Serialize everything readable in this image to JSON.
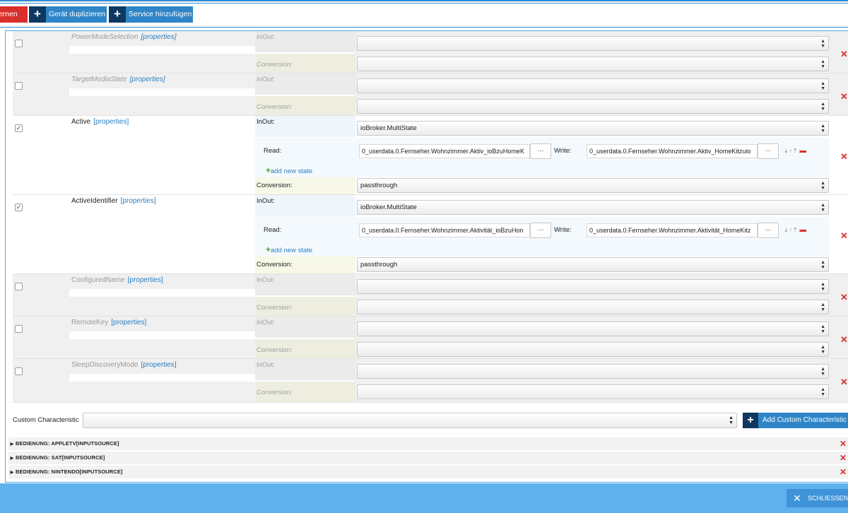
{
  "toolbar": {
    "remove_label": "tfernen",
    "duplicate_label": "Gerät duplizieren",
    "add_service_label": "Service hinzufügen"
  },
  "characteristics": [
    {
      "name": "PowerModeSelection",
      "props": "[properties]",
      "inout_label": "InOut:",
      "inout_value": "",
      "conversion_label": "Conversion:",
      "conversion_value": "",
      "checked": false
    },
    {
      "name": "TargetMediaState",
      "props": "[properties]",
      "inout_label": "InOut:",
      "inout_value": "",
      "conversion_label": "Conversion:",
      "conversion_value": "",
      "checked": false
    },
    {
      "name": "Active",
      "props": "[properties]",
      "inout_label": "InOut:",
      "inout_value": "ioBroker.MultiState",
      "read_label": "Read:",
      "read_value": "0_userdata.0.Fernseher.Wohnzimmer.Aktiv_ioBzuHomeK",
      "write_label": "Write:",
      "write_value": "0_userdata.0.Fernseher.Wohnzimmer.Aktiv_HomeKitzuio",
      "dots": "···",
      "add_state": "add new state",
      "conversion_label": "Conversion:",
      "conversion_value": "passthrough",
      "checked": true
    },
    {
      "name": "ActiveIdentifier",
      "props": "[properties]",
      "inout_label": "InOut:",
      "inout_value": "ioBroker.MultiState",
      "read_label": "Read:",
      "read_value": "0_userdata.0.Fernseher.Wohnzimmer.Aktivität_ioBzuHon",
      "write_label": "Write:",
      "write_value": "0_userdata.0.Fernseher.Wohnzimmer.Aktivität_HomeKitz",
      "dots": "···",
      "add_state": "add new state",
      "conversion_label": "Conversion:",
      "conversion_value": "passthrough",
      "checked": true
    },
    {
      "name": "ConfiguredName",
      "props": "[properties]",
      "inout_label": "InOut:",
      "inout_value": "",
      "conversion_label": "Conversion:",
      "conversion_value": "",
      "checked": false
    },
    {
      "name": "RemoteKey",
      "props": "[properties]",
      "inout_label": "InOut:",
      "inout_value": "",
      "conversion_label": "Conversion:",
      "conversion_value": "",
      "checked": false
    },
    {
      "name": "SleepDiscoveryMode",
      "props": "[properties]",
      "inout_label": "InOut:",
      "inout_value": "",
      "conversion_label": "Conversion:",
      "conversion_value": "",
      "checked": false
    }
  ],
  "custom": {
    "label": "Custom Characteristic",
    "value": "",
    "add_label": "Add Custom Characteristic"
  },
  "services": [
    {
      "label": "BEDIENUNG: APPLETV[INPUTSOURCE]"
    },
    {
      "label": "BEDIENUNG: SAT[INPUTSOURCE]"
    },
    {
      "label": "BEDIENUNG: NINTENDO[INPUTSOURCE]"
    }
  ],
  "footer": {
    "close_label": "SCHLIESSEN"
  },
  "colors": {
    "accent_blue": "#2e85c7",
    "dark_blue": "#0e3860",
    "danger_red": "#d9302c",
    "footer_blue": "#5fb2ee"
  }
}
